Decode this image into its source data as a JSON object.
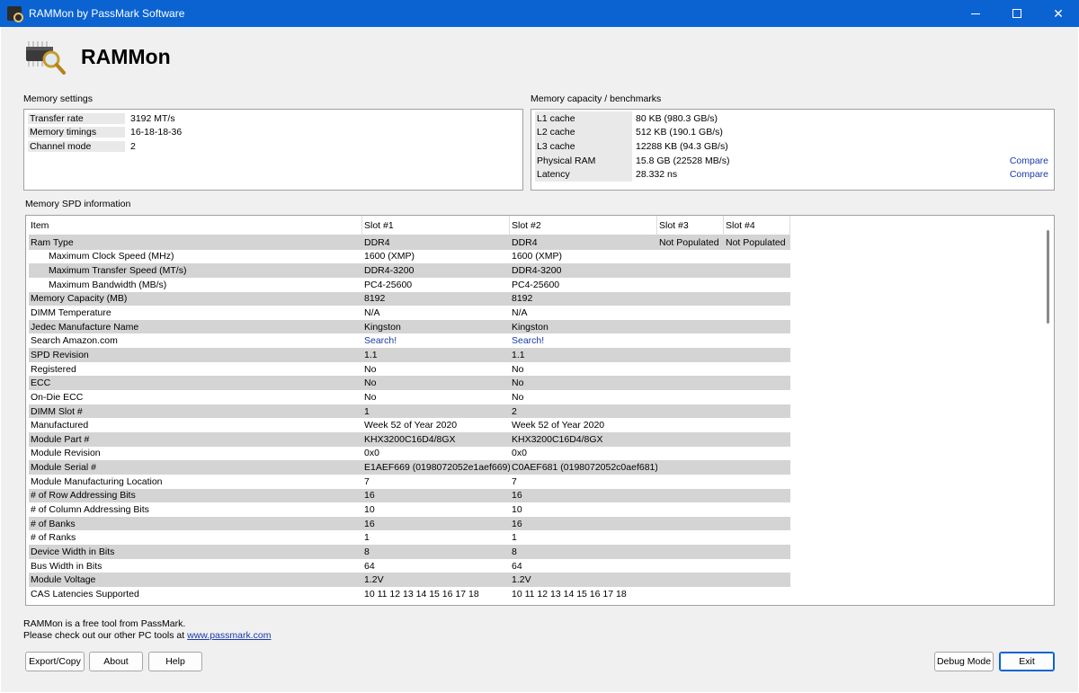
{
  "window": {
    "title": "RAMMon by PassMark Software"
  },
  "app": {
    "name": "RAMMon"
  },
  "memory_settings": {
    "label": "Memory settings",
    "rows": [
      {
        "key": "Transfer rate",
        "value": "3192 MT/s"
      },
      {
        "key": "Memory timings",
        "value": "16-18-18-36"
      },
      {
        "key": "Channel mode",
        "value": "2"
      }
    ]
  },
  "capacity": {
    "label": "Memory capacity / benchmarks",
    "rows": [
      {
        "key": "L1 cache",
        "value": "80 KB (980.3 GB/s)",
        "link": ""
      },
      {
        "key": "L2 cache",
        "value": "512 KB (190.1 GB/s)",
        "link": ""
      },
      {
        "key": "L3 cache",
        "value": "12288 KB (94.3 GB/s)",
        "link": ""
      },
      {
        "key": "Physical RAM",
        "value": "15.8 GB (22528 MB/s)",
        "link": "Compare"
      },
      {
        "key": "Latency",
        "value": "28.332 ns",
        "link": "Compare"
      }
    ]
  },
  "spd": {
    "label": "Memory SPD information",
    "headers": [
      "Item",
      "Slot #1",
      "Slot #2",
      "Slot #3",
      "Slot #4"
    ],
    "rows": [
      {
        "item": "Ram Type",
        "s1": "DDR4",
        "s2": "DDR4",
        "s3": "Not Populated",
        "s4": "Not Populated",
        "gray": true
      },
      {
        "item": "Maximum Clock Speed (MHz)",
        "s1": "1600 (XMP)",
        "s2": "1600 (XMP)",
        "s3": "",
        "s4": "",
        "indent": true
      },
      {
        "item": "Maximum Transfer Speed (MT/s)",
        "s1": "DDR4-3200",
        "s2": "DDR4-3200",
        "s3": "",
        "s4": "",
        "indent": true,
        "gray": true
      },
      {
        "item": "Maximum Bandwidth (MB/s)",
        "s1": "PC4-25600",
        "s2": "PC4-25600",
        "s3": "",
        "s4": "",
        "indent": true
      },
      {
        "item": "Memory Capacity (MB)",
        "s1": "8192",
        "s2": "8192",
        "s3": "",
        "s4": "",
        "gray": true
      },
      {
        "item": "DIMM Temperature",
        "s1": "N/A",
        "s2": "N/A",
        "s3": "",
        "s4": ""
      },
      {
        "item": "Jedec Manufacture Name",
        "s1": "Kingston",
        "s2": "Kingston",
        "s3": "",
        "s4": "",
        "gray": true
      },
      {
        "item": "Search Amazon.com",
        "s1": "Search!",
        "s2": "Search!",
        "s3": "",
        "s4": "",
        "link": true
      },
      {
        "item": "SPD Revision",
        "s1": "1.1",
        "s2": "1.1",
        "s3": "",
        "s4": "",
        "gray": true
      },
      {
        "item": "Registered",
        "s1": "No",
        "s2": "No",
        "s3": "",
        "s4": ""
      },
      {
        "item": "ECC",
        "s1": "No",
        "s2": "No",
        "s3": "",
        "s4": "",
        "gray": true
      },
      {
        "item": "On-Die ECC",
        "s1": "No",
        "s2": "No",
        "s3": "",
        "s4": ""
      },
      {
        "item": "DIMM Slot #",
        "s1": "1",
        "s2": "2",
        "s3": "",
        "s4": "",
        "gray": true
      },
      {
        "item": "Manufactured",
        "s1": "Week 52 of Year 2020",
        "s2": "Week 52 of Year 2020",
        "s3": "",
        "s4": ""
      },
      {
        "item": "Module Part #",
        "s1": "KHX3200C16D4/8GX",
        "s2": "KHX3200C16D4/8GX",
        "s3": "",
        "s4": "",
        "gray": true
      },
      {
        "item": "Module Revision",
        "s1": "0x0",
        "s2": "0x0",
        "s3": "",
        "s4": ""
      },
      {
        "item": "Module Serial #",
        "s1": "E1AEF669 (0198072052e1aef669)",
        "s2": "C0AEF681 (0198072052c0aef681)",
        "s3": "",
        "s4": "",
        "gray": true
      },
      {
        "item": "Module Manufacturing Location",
        "s1": "7",
        "s2": "7",
        "s3": "",
        "s4": ""
      },
      {
        "item": "# of Row Addressing Bits",
        "s1": "16",
        "s2": "16",
        "s3": "",
        "s4": "",
        "gray": true
      },
      {
        "item": "# of Column Addressing Bits",
        "s1": "10",
        "s2": "10",
        "s3": "",
        "s4": ""
      },
      {
        "item": "# of Banks",
        "s1": "16",
        "s2": "16",
        "s3": "",
        "s4": "",
        "gray": true
      },
      {
        "item": "# of Ranks",
        "s1": "1",
        "s2": "1",
        "s3": "",
        "s4": ""
      },
      {
        "item": "Device Width in Bits",
        "s1": "8",
        "s2": "8",
        "s3": "",
        "s4": "",
        "gray": true
      },
      {
        "item": "Bus Width in Bits",
        "s1": "64",
        "s2": "64",
        "s3": "",
        "s4": ""
      },
      {
        "item": "Module Voltage",
        "s1": "1.2V",
        "s2": "1.2V",
        "s3": "",
        "s4": "",
        "gray": true
      },
      {
        "item": "CAS Latencies Supported",
        "s1": "10 11 12 13 14 15 16 17 18",
        "s2": "10 11 12 13 14 15 16 17 18",
        "s3": "",
        "s4": ""
      }
    ]
  },
  "footer": {
    "line1": "RAMMon is a free tool from PassMark.",
    "line2": "Please check out our other PC tools at ",
    "link": "www.passmark.com"
  },
  "buttons": {
    "export": "Export/Copy",
    "about": "About",
    "help": "Help",
    "debug": "Debug Mode",
    "exit": "Exit"
  }
}
